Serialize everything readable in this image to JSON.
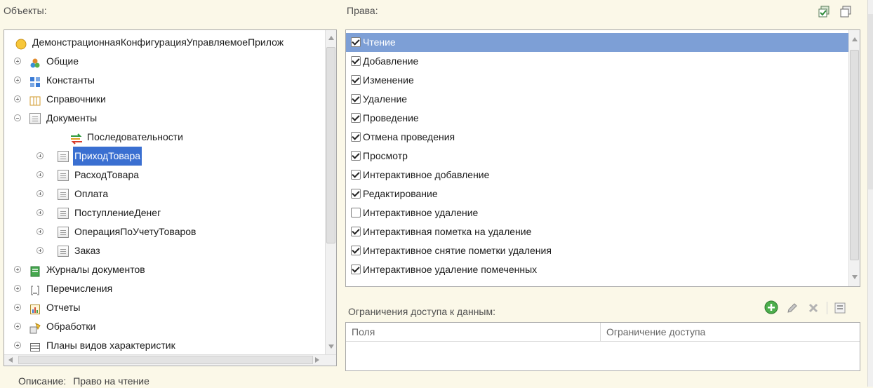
{
  "objects_panel": {
    "label": "Объекты:",
    "items": [
      {
        "label": "ДемонстрационнаяКонфигурацияУправляемоеПрилож",
        "icon": "config-root-icon",
        "expander": "none",
        "level": 0
      },
      {
        "label": "Общие",
        "icon": "common-icon",
        "expander": "plus",
        "level": 0
      },
      {
        "label": "Константы",
        "icon": "constants-icon",
        "expander": "plus",
        "level": 0
      },
      {
        "label": "Справочники",
        "icon": "catalogs-icon",
        "expander": "plus",
        "level": 0
      },
      {
        "label": "Документы",
        "icon": "documents-icon",
        "expander": "minus",
        "level": 0
      },
      {
        "label": "Последовательности",
        "icon": "sequences-icon",
        "expander": "none",
        "level": 1
      },
      {
        "label": "ПриходТовара",
        "icon": "document-icon",
        "expander": "plus",
        "level": 1,
        "selected": true
      },
      {
        "label": "РасходТовара",
        "icon": "document-icon",
        "expander": "plus",
        "level": 1
      },
      {
        "label": "Оплата",
        "icon": "document-icon",
        "expander": "plus",
        "level": 1
      },
      {
        "label": "ПоступлениеДенег",
        "icon": "document-icon",
        "expander": "plus",
        "level": 1
      },
      {
        "label": "ОперацияПоУчетуТоваров",
        "icon": "document-icon",
        "expander": "plus",
        "level": 1
      },
      {
        "label": "Заказ",
        "icon": "document-icon",
        "expander": "plus",
        "level": 1
      },
      {
        "label": "Журналы документов",
        "icon": "journals-icon",
        "expander": "plus",
        "level": 0
      },
      {
        "label": "Перечисления",
        "icon": "enums-icon",
        "expander": "plus",
        "level": 0
      },
      {
        "label": "Отчеты",
        "icon": "reports-icon",
        "expander": "plus",
        "level": 0
      },
      {
        "label": "Обработки",
        "icon": "processing-icon",
        "expander": "plus",
        "level": 0
      },
      {
        "label": "Планы видов характеристик",
        "icon": "characteristics-icon",
        "expander": "plus",
        "level": 0
      }
    ]
  },
  "rights_panel": {
    "label": "Права:",
    "items": [
      {
        "label": "Чтение",
        "checked": true,
        "selected": true
      },
      {
        "label": "Добавление",
        "checked": true
      },
      {
        "label": "Изменение",
        "checked": true
      },
      {
        "label": "Удаление",
        "checked": true
      },
      {
        "label": "Проведение",
        "checked": true
      },
      {
        "label": "Отмена проведения",
        "checked": true
      },
      {
        "label": "Просмотр",
        "checked": true
      },
      {
        "label": "Интерактивное добавление",
        "checked": true
      },
      {
        "label": "Редактирование",
        "checked": true
      },
      {
        "label": "Интерактивное удаление",
        "checked": false
      },
      {
        "label": "Интерактивная пометка на удаление",
        "checked": true
      },
      {
        "label": "Интерактивное снятие пометки удаления",
        "checked": true
      },
      {
        "label": "Интерактивное удаление помеченных",
        "checked": true
      }
    ]
  },
  "restrictions": {
    "label": "Ограничения доступа к данным:",
    "columns": [
      "Поля",
      "Ограничение доступа"
    ]
  },
  "description": {
    "label": "Описание:",
    "value": "Право на чтение"
  },
  "colors": {
    "tree_selection": "#3a6fd1",
    "list_selection": "#7d9fd6",
    "background": "#fbf8e8"
  }
}
